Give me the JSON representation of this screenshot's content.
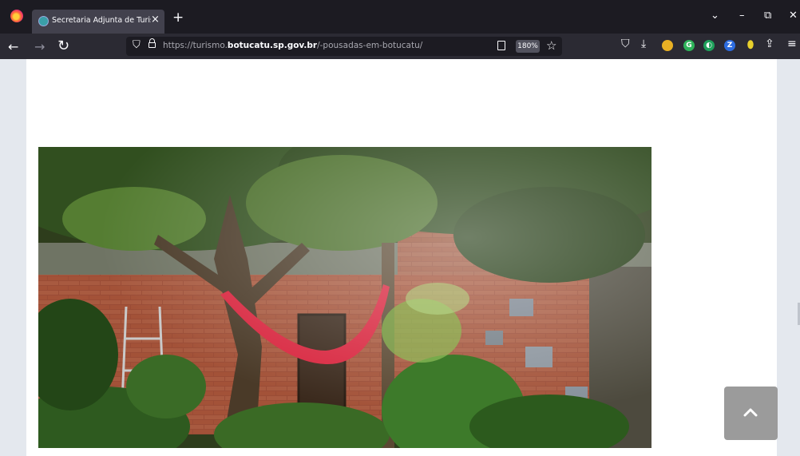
{
  "browser": {
    "tab_title": "Secretaria Adjunta de Turismo -",
    "tab_close": "×",
    "new_tab": "+",
    "url_prefix": "https://turismo.",
    "url_domain": "botucatu.sp.gov.br",
    "url_path": "/-pousadas-em-botucatu/",
    "zoom": "180%",
    "window_controls": {
      "minimize": "–",
      "maximize": "⧉",
      "close": "✕",
      "tab_list": "⌄"
    },
    "nav": {
      "back": "←",
      "forward": "→",
      "reload": "↻"
    },
    "toolbar_icons": [
      "pocket-icon",
      "download-icon",
      "extension-yellow-icon",
      "extension-green-g-icon",
      "extension-green-circle-icon",
      "extension-blue-z-icon",
      "extension-location-icon",
      "share-icon",
      "menu-icon"
    ]
  },
  "page": {
    "image_description_name": "garden-hammock-photo",
    "back_to_top": "back-to-top"
  },
  "colors": {
    "titlebar": "#1c1b22",
    "navbar": "#2b2a33",
    "page_bg": "#e4e8ee",
    "content_bg": "#ffffff",
    "hammock": "#d8253e",
    "back_top_button": "#9b9b9b"
  }
}
